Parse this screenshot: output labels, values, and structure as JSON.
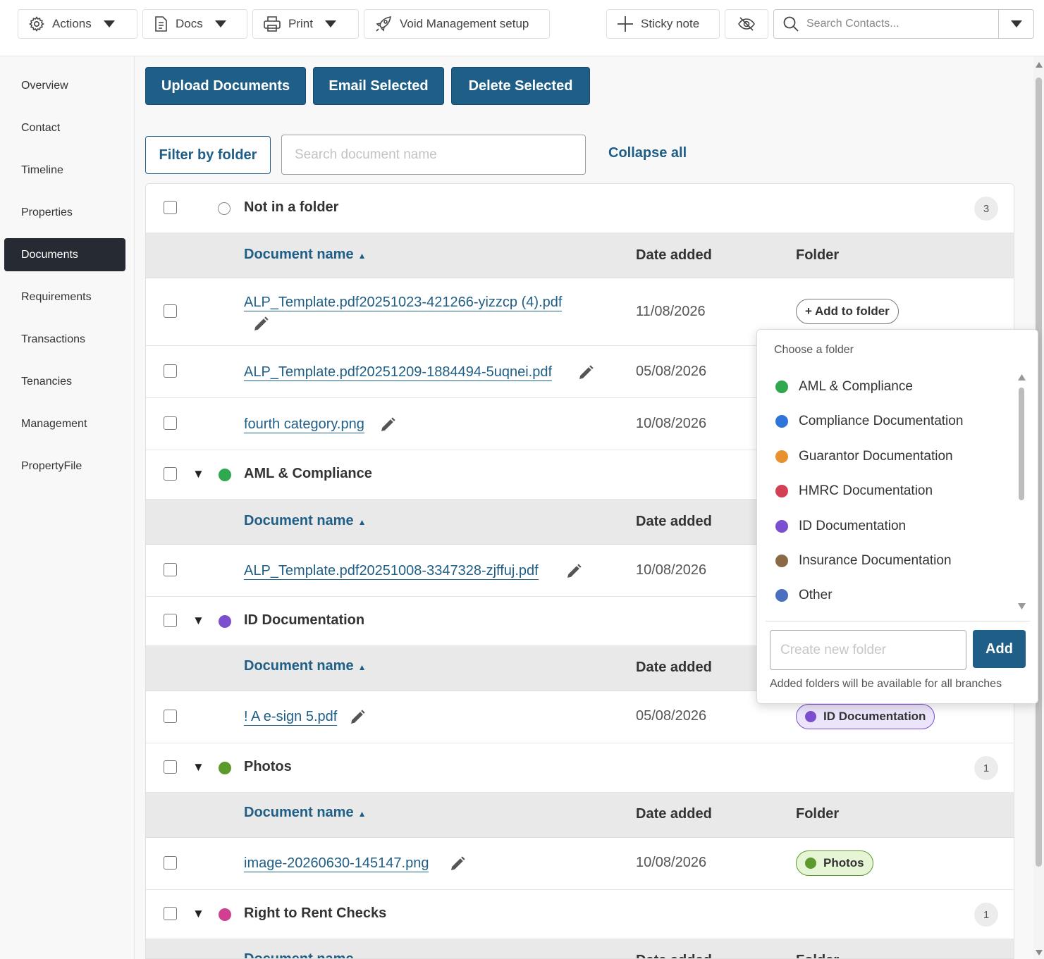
{
  "toolbar": {
    "actions_label": "Actions",
    "docs_label": "Docs",
    "print_label": "Print",
    "void_label": "Void Management setup",
    "sticky_label": "Sticky note",
    "search_placeholder": "Search Contacts..."
  },
  "sidebar": {
    "items": [
      {
        "label": "Overview"
      },
      {
        "label": "Contact"
      },
      {
        "label": "Timeline"
      },
      {
        "label": "Properties"
      },
      {
        "label": "Documents",
        "active": true
      },
      {
        "label": "Requirements"
      },
      {
        "label": "Transactions"
      },
      {
        "label": "Tenancies"
      },
      {
        "label": "Management"
      },
      {
        "label": "PropertyFile"
      }
    ]
  },
  "actions": {
    "upload": "Upload Documents",
    "email": "Email Selected",
    "delete": "Delete Selected",
    "filter": "Filter by folder",
    "search_placeholder": "Search document name",
    "collapse": "Collapse all"
  },
  "columns": {
    "name": "Document name",
    "sort_arrow": "▲",
    "date": "Date added",
    "folder": "Folder"
  },
  "groups": {
    "none": {
      "name": "Not in a folder",
      "count": "3"
    },
    "aml": {
      "name": "AML & Compliance",
      "color": "#2fa84f"
    },
    "id": {
      "name": "ID Documentation",
      "color": "#7c4fcf"
    },
    "photos": {
      "name": "Photos",
      "count": "1",
      "color": "#5c9a2e"
    },
    "rtr": {
      "name": "Right to Rent Checks",
      "count": "1",
      "color": "#cf3f92"
    }
  },
  "docs": {
    "d1": {
      "name": "ALP_Template.pdf20251023-421266-yizzcp (4).pdf",
      "date": "11/08/2026",
      "folder_action": "+ Add to folder"
    },
    "d2": {
      "name": "ALP_Template.pdf20251209-1884494-5uqnei.pdf",
      "date": "05/08/2026"
    },
    "d3": {
      "name": "fourth category.png",
      "date": "10/08/2026"
    },
    "d4": {
      "name": "ALP_Template.pdf20251008-3347328-zjffuj.pdf",
      "date": "10/08/2026"
    },
    "d5": {
      "name": "! A e-sign 5.pdf",
      "date": "05/08/2026",
      "folder": "ID Documentation"
    },
    "d6": {
      "name": "image-20260630-145147.png",
      "date": "10/08/2026",
      "folder": "Photos"
    }
  },
  "dropdown": {
    "title": "Choose a folder",
    "folders": [
      {
        "name": "AML & Compliance",
        "color": "#2fa84f"
      },
      {
        "name": "Compliance Documentation",
        "color": "#2f74d8"
      },
      {
        "name": "Guarantor Documentation",
        "color": "#e8912f"
      },
      {
        "name": "HMRC Documentation",
        "color": "#d33f55"
      },
      {
        "name": "ID Documentation",
        "color": "#7c4fcf"
      },
      {
        "name": "Insurance Documentation",
        "color": "#8a6a45"
      },
      {
        "name": "Other",
        "color": "#4a6fbf"
      }
    ],
    "new_placeholder": "Create new folder",
    "add_label": "Add",
    "note": "Added folders will be available for all branches"
  },
  "colors": {
    "brand": "#1f5e86",
    "nav_active": "#262b33"
  }
}
